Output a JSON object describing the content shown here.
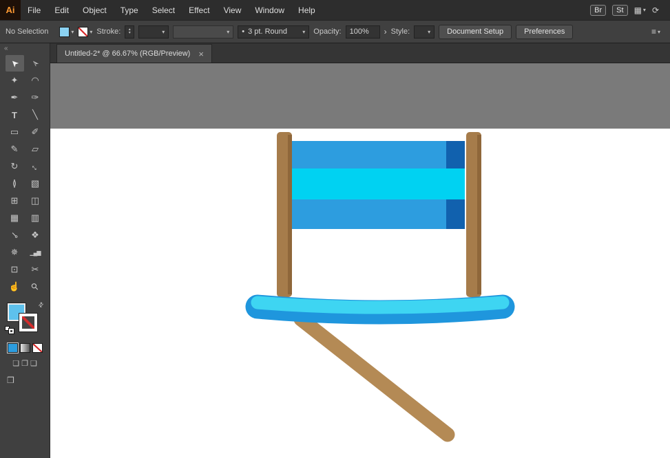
{
  "menubar": {
    "logo": "Ai",
    "items": [
      "File",
      "Edit",
      "Object",
      "Type",
      "Select",
      "Effect",
      "View",
      "Window",
      "Help"
    ],
    "bridge_label": "Br",
    "stock_label": "St"
  },
  "icons": {
    "workspace": "▦",
    "sync": "⟳",
    "panel_list": "≡",
    "chevron": "▾",
    "chevron_right": "›",
    "spin_up": "▴",
    "spin_down": "▾",
    "swap": "⇄",
    "collapse": "«",
    "draw_normal": "❏",
    "draw_behind": "❐",
    "draw_inside": "❑",
    "screen_mode": "❒"
  },
  "controlbar": {
    "selection_status": "No Selection",
    "stroke_label": "Stroke:",
    "brush_bullet": "•",
    "brush_value": "3 pt. Round",
    "opacity_label": "Opacity:",
    "opacity_value": "100%",
    "style_label": "Style:",
    "document_setup_label": "Document Setup",
    "preferences_label": "Preferences"
  },
  "tab": {
    "title": "Untitled-2* @ 66.67% (RGB/Preview)",
    "close_glyph": "×"
  },
  "toolbar": {
    "tools": [
      {
        "name": "selection",
        "glyph": "➤"
      },
      {
        "name": "direct-selection",
        "glyph": "➢"
      },
      {
        "name": "magic-wand",
        "glyph": "✦"
      },
      {
        "name": "lasso",
        "glyph": "◠"
      },
      {
        "name": "pen",
        "glyph": "✒"
      },
      {
        "name": "curvature",
        "glyph": "✑"
      },
      {
        "name": "type",
        "glyph": "T"
      },
      {
        "name": "line-segment",
        "glyph": "╲"
      },
      {
        "name": "rectangle",
        "glyph": "▭"
      },
      {
        "name": "paintbrush",
        "glyph": "✐"
      },
      {
        "name": "pencil",
        "glyph": "✎"
      },
      {
        "name": "eraser",
        "glyph": "▱"
      },
      {
        "name": "rotate",
        "glyph": "↻"
      },
      {
        "name": "scale",
        "glyph": "↔"
      },
      {
        "name": "width",
        "glyph": "≬"
      },
      {
        "name": "free-transform",
        "glyph": "▧"
      },
      {
        "name": "perspective-grid",
        "glyph": "⊞"
      },
      {
        "name": "shape-builder",
        "glyph": "◫"
      },
      {
        "name": "mesh",
        "glyph": "▦"
      },
      {
        "name": "gradient",
        "glyph": "▥"
      },
      {
        "name": "eyedropper",
        "glyph": "⊸"
      },
      {
        "name": "blend",
        "glyph": "❖"
      },
      {
        "name": "symbol-sprayer",
        "glyph": "✵"
      },
      {
        "name": "column-graph",
        "glyph": "▁▄▆"
      },
      {
        "name": "artboard",
        "glyph": "⊡"
      },
      {
        "name": "slice",
        "glyph": "✂"
      },
      {
        "name": "hand",
        "glyph": "☝"
      },
      {
        "name": "zoom",
        "glyph": "⚲"
      }
    ]
  },
  "artwork": {
    "colors": {
      "pasteboard": "#7a7a7a",
      "artboard": "#ffffff",
      "post": "#a67c4b",
      "post_shade": "#8f673a",
      "leg": "#b48a55",
      "stripe_blue": "#2d9ddf",
      "stripe_cyan": "#00d2f2",
      "stripe_dark": "#1161ae",
      "seat_blue": "#1f96dd",
      "seat_cyan": "#3ed5f2",
      "fill_current": "#5ec1ec",
      "cb_fill": "#8bd2f2"
    }
  }
}
